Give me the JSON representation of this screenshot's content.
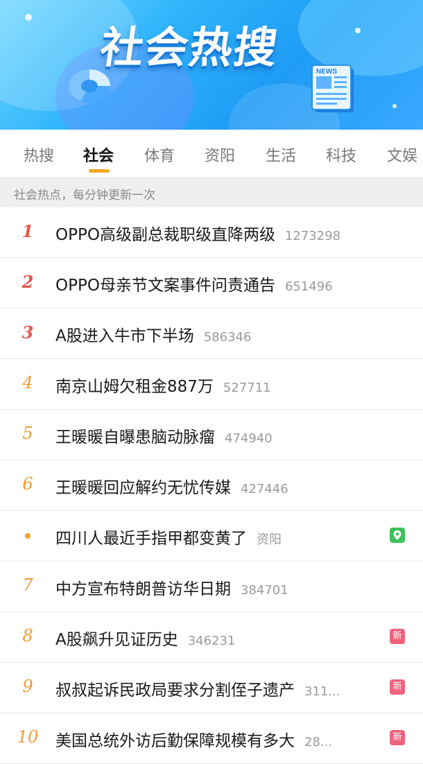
{
  "banner": {
    "title": "社会热搜",
    "news_label": "NEWS"
  },
  "tabs": [
    {
      "label": "热搜"
    },
    {
      "label": "社会"
    },
    {
      "label": "体育"
    },
    {
      "label": "资阳"
    },
    {
      "label": "生活"
    },
    {
      "label": "科技"
    },
    {
      "label": "文娱"
    }
  ],
  "active_tab": "社会",
  "subheader": "社会热点，每分钟更新一次",
  "list": [
    {
      "rank": "1",
      "title": "OPPO高级副总裁职级直降两级",
      "count": "1273298"
    },
    {
      "rank": "2",
      "title": "OPPO母亲节文案事件问责通告",
      "count": "651496"
    },
    {
      "rank": "3",
      "title": "A股进入牛市下半场",
      "count": "586346"
    },
    {
      "rank": "4",
      "title": "南京山姆欠租金887万",
      "count": "527711"
    },
    {
      "rank": "5",
      "title": "王暖暖自曝患脑动脉瘤",
      "count": "474940"
    },
    {
      "rank": "6",
      "title": "王暖暖回应解约无忧传媒",
      "count": "427446"
    },
    {
      "rank": "",
      "title": "四川人最近手指甲都变黄了",
      "count": "资阳",
      "badge": "location-icon"
    },
    {
      "rank": "7",
      "title": "中方宣布特朗普访华日期",
      "count": "384701"
    },
    {
      "rank": "8",
      "title": "A股飙升见证历史",
      "count": "346231",
      "badge": "新"
    },
    {
      "rank": "9",
      "title": "叔叔起诉民政局要求分割侄子遗产",
      "count": "311...",
      "badge": "新"
    },
    {
      "rank": "10",
      "title": "美国总统外访后勤保障规模有多大",
      "count": "28...",
      "badge": "新"
    }
  ],
  "colors": {
    "rank_top": "#e8554d",
    "rank_other": "#f29a30",
    "tab_accent": "#f5a623",
    "badge_new": "#f0627d",
    "badge_location": "#3fbf5a"
  }
}
